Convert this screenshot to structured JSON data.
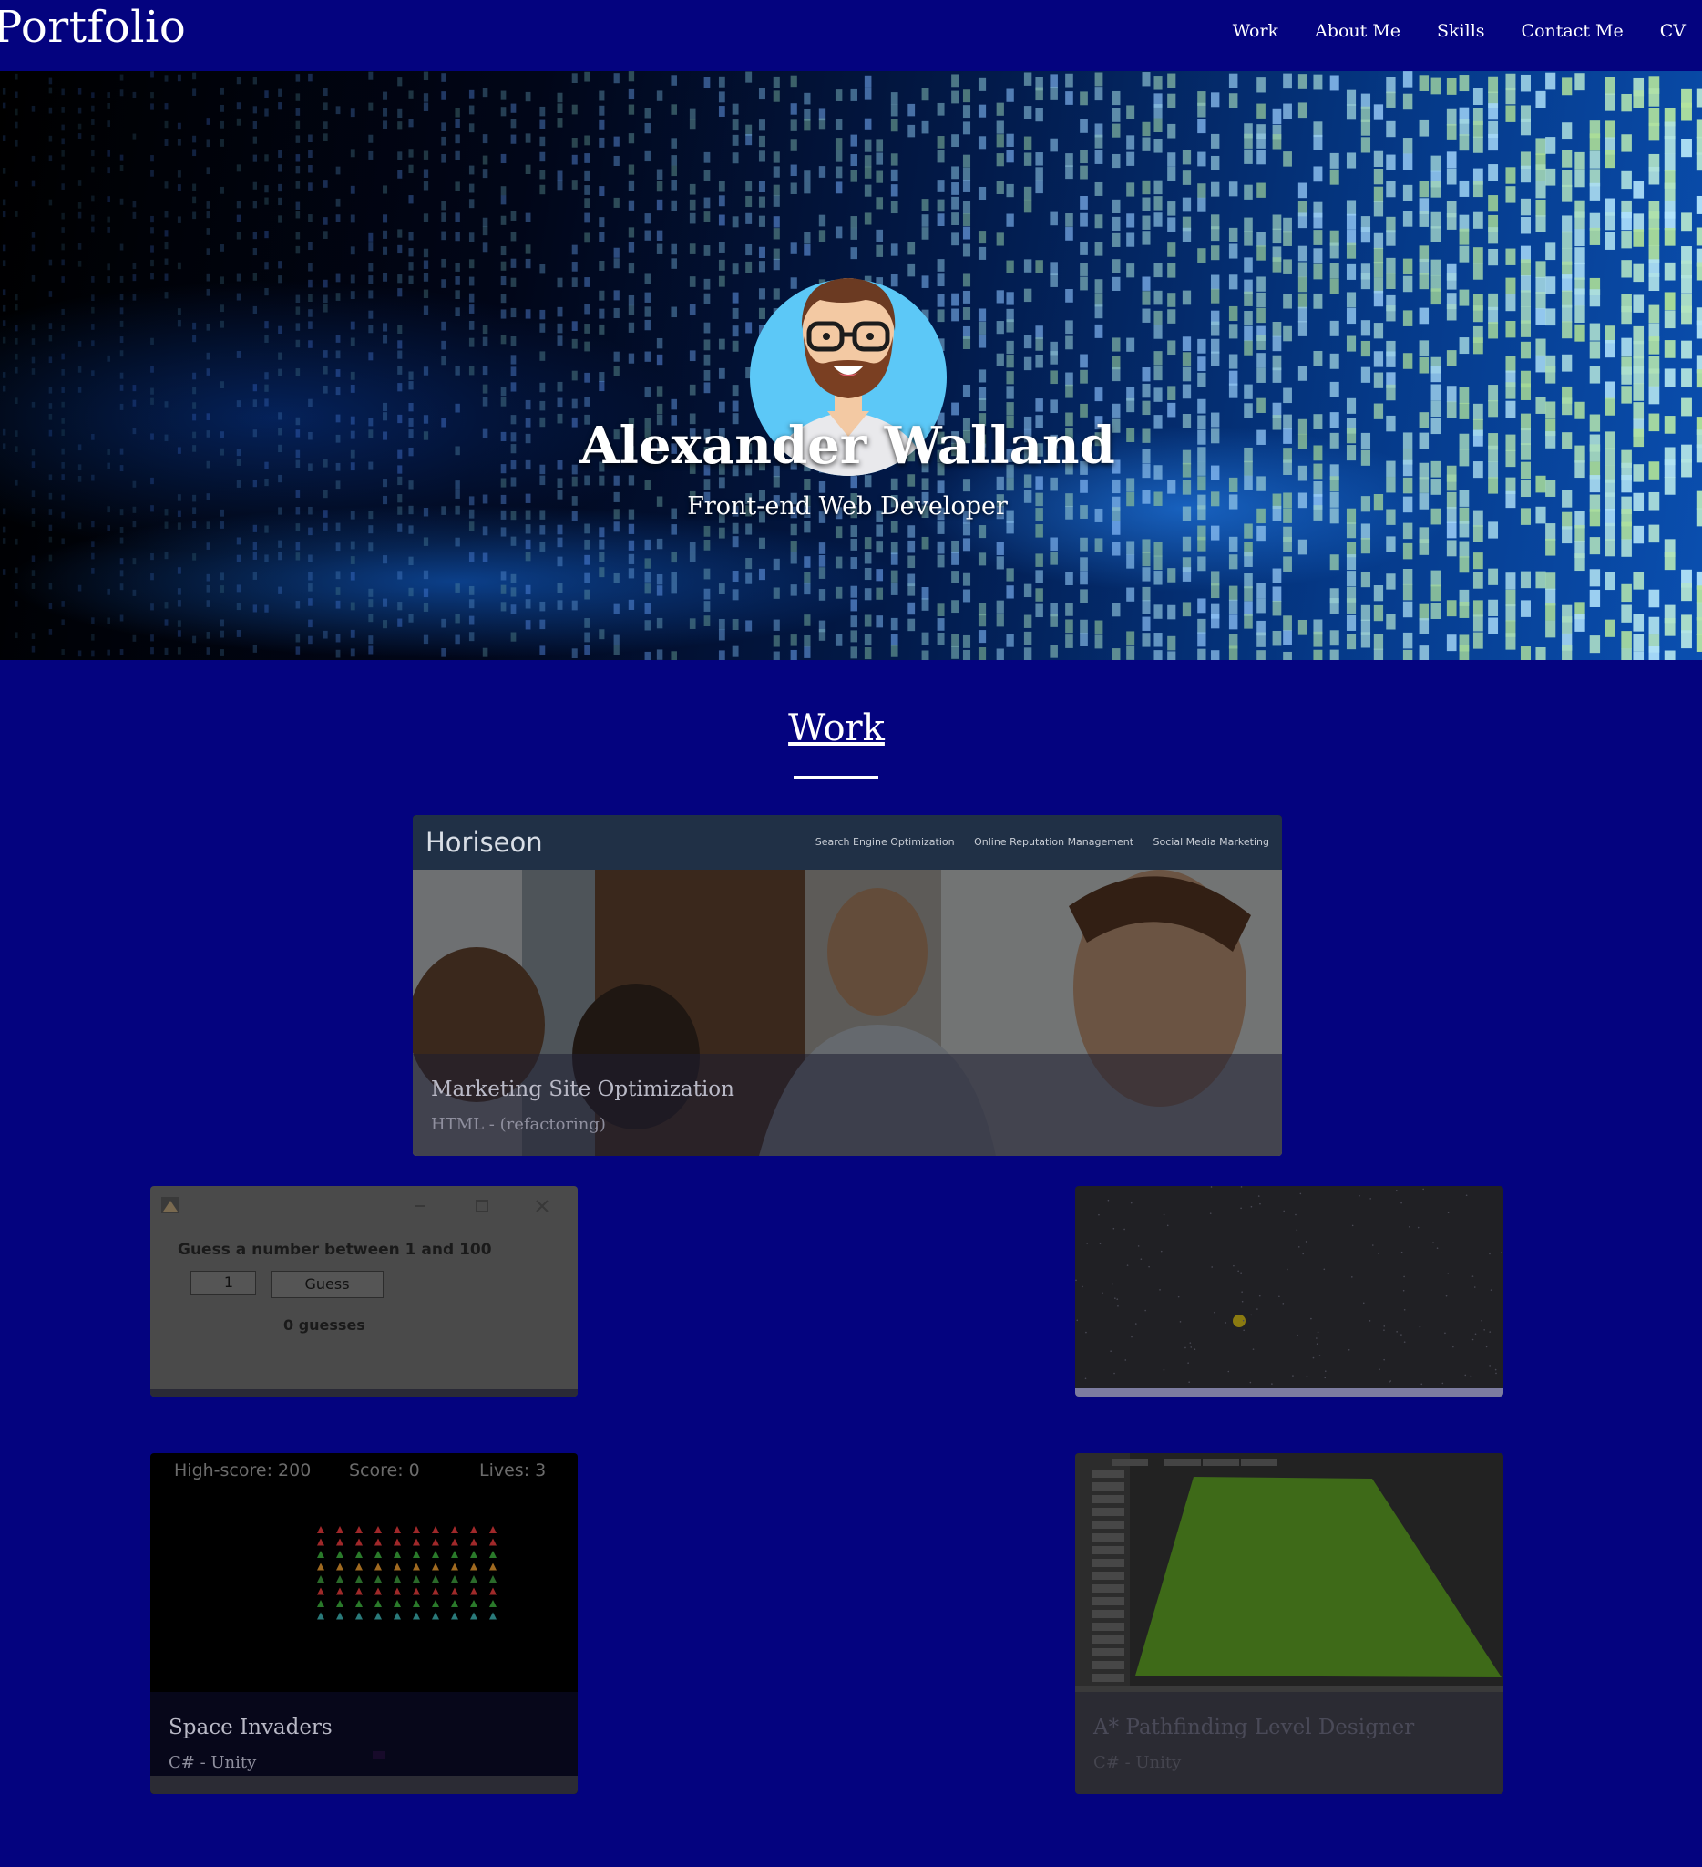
{
  "header": {
    "brand": "Portfolio",
    "nav": [
      "Work",
      "About Me",
      "Skills",
      "Contact Me",
      "CV"
    ]
  },
  "hero": {
    "name": "Alexander Walland",
    "role": "Front-end Web Developer"
  },
  "work": {
    "title": "Work",
    "featured": {
      "site_logo": "Horiseon",
      "site_links": [
        "Search Engine Optimization",
        "Online Reputation Management",
        "Social Media Marketing"
      ],
      "title": "Marketing Site Optimization",
      "subtitle": "HTML - (refactoring)"
    },
    "guess_game": {
      "prompt": "Guess a number between 1 and 100",
      "input_value": "1",
      "button": "Guess",
      "count": "0 guesses"
    },
    "space_invaders": {
      "hud_highscore": "High-score: 200",
      "hud_score": "Score: 0",
      "hud_lives": "Lives: 3",
      "title": "Space Invaders",
      "subtitle": "C# - Unity"
    },
    "astar": {
      "title": "A* Pathfinding Level Designer",
      "subtitle": "C# - Unity"
    }
  },
  "colors": {
    "background": "#04037f",
    "text": "#ffffff"
  }
}
